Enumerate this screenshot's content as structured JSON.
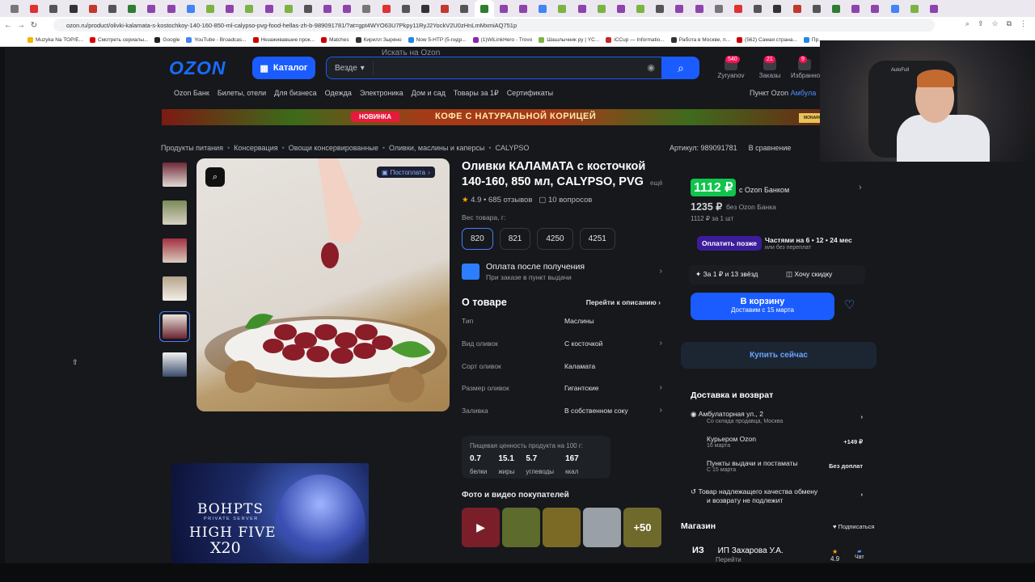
{
  "browser": {
    "tab_count": 48,
    "url": "ozon.ru/product/olivki-kalamata-s-kostochkoy-140-160-850-ml-calypso-pvg-food-hellas-zh-b-989091781/?at=gpt4WYO63U7Pkpy11RyJ2YockV2U0zHnLmMxmiAQ751p",
    "bookmarks": [
      "Muzyka Na TOP/E...",
      "Смотреть сериалы...",
      "Google",
      "YouTube - Broadcas...",
      "Незаживавшие прок...",
      "Matches",
      "Кирилл Зыряно",
      "Now 5-HTP (5-гидр...",
      "(1)WiLinkHero - Trovo",
      "Шашлычник ру | YC...",
      "iCCup — Informatio...",
      "Работа в Москве, п...",
      "(562) Самая страна...",
      "Пр..."
    ]
  },
  "header": {
    "logo": "OZON",
    "catalog": "Каталог",
    "search_scope": "Везде",
    "search_placeholder": "Искать на Ozon",
    "user": [
      {
        "label": "Zyryanov",
        "badge": "540"
      },
      {
        "label": "Заказы",
        "badge": "21"
      },
      {
        "label": "Избранно",
        "badge": "9"
      }
    ]
  },
  "subnav": [
    "Ozon Банк",
    "Билеты, отели",
    "Для бизнеса",
    "Одежда",
    "Электроника",
    "Дом и сад",
    "Товары за 1₽",
    "Сертификаты"
  ],
  "pickup": {
    "label": "Пункт Ozon",
    "value": "Амбула"
  },
  "promo": {
    "tag": "НОВИНКА",
    "text": "КОФЕ С НАТУРАЛЬНОЙ КОРИЦЕЙ",
    "brand": "MONARCH"
  },
  "breadcrumbs": [
    "Продукты питания",
    "Консервация",
    "Овощи консервированные",
    "Оливки, маслины и каперсы",
    "CALYPSO"
  ],
  "article": {
    "label": "Артикул: 989091781",
    "compare": "В сравнение"
  },
  "product": {
    "postoplata": "Постоплата",
    "title_line1": "Оливки КАЛАМАТА с косточкой",
    "title_line2": "140-160, 850 мл, CALYPSO, PVG",
    "more": "ещё",
    "rating": "4.9",
    "reviews": "685 отзывов",
    "questions": "10 вопросов",
    "weight_label": "Вес товара, г:",
    "weights": [
      "820",
      "821",
      "4250",
      "4251"
    ],
    "weight_selected_index": 0,
    "pay_after": {
      "title": "Оплата после получения",
      "sub": "При заказе в пункт выдачи"
    },
    "about_title": "О товаре",
    "about_link": "Перейти к описанию",
    "attributes": [
      {
        "k": "Тип",
        "v": "Маслины"
      },
      {
        "k": "Вид оливок",
        "v": "С косточкой"
      },
      {
        "k": "Сорт оливок",
        "v": "Каламата"
      },
      {
        "k": "Размер оливок",
        "v": "Гигантские"
      },
      {
        "k": "Заливка",
        "v": "В собственном соку"
      }
    ],
    "nutrition": {
      "title": "Пищевая ценность продукта на 100 г:",
      "values": [
        {
          "v": "0.7",
          "k": "белки"
        },
        {
          "v": "15.1",
          "k": "жиры"
        },
        {
          "v": "5.7",
          "k": "углеводы"
        },
        {
          "v": "167",
          "k": "ккал"
        }
      ]
    },
    "photos_title": "Фото и видео покупателей",
    "photos_more": "+50"
  },
  "ad": {
    "line1": "BOHPTS",
    "line2": "PRIVATE SERVER",
    "line3": "HIGH FIVE",
    "line4": "X20"
  },
  "price": {
    "ozon_bank": "1112 ₽",
    "ozon_bank_label": "с Ozon Банком",
    "regular": "1235 ₽",
    "regular_label": "без Ozon Банка",
    "per_unit": "1112 ₽ за 1 шт",
    "pay_later_btn": "Оплатить позже",
    "pay_later_text": "Частями на 6 • 12 • 24 мес",
    "pay_later_sub": "или без переплат",
    "bonus": "За 1 ₽ и 13 звёзд",
    "discount": "Хочу скидку",
    "cart": "В корзину",
    "cart_sub": "Доставим с 15 марта",
    "buy_now": "Купить сейчас"
  },
  "delivery": {
    "title": "Доставка и возврат",
    "address": "Амбулаторная ул., 2",
    "address_sub": "Со склада продавца, Москва",
    "rows": [
      {
        "t": "Курьером Ozon",
        "s": "16 марта",
        "r": "+149 ₽"
      },
      {
        "t": "Пункты выдачи и постаматы",
        "s": "С 15 марта",
        "r": "Без доплат"
      }
    ],
    "return_text_1": "Товар надлежащего качества обмену",
    "return_text_2": "и возврату не подлежит"
  },
  "shop": {
    "title": "Магазин",
    "subscribe": "Подписаться",
    "name": "ИП Захарова У.А.",
    "logo": "ИЗ",
    "go": "Перейти",
    "rating": "4.9",
    "chat": "Чат"
  },
  "webcam": {
    "label": "AutoFull"
  },
  "colors": {
    "bg": "#16181c",
    "accent": "#1a5cff",
    "green": "#10c44c",
    "pink": "#f91155"
  }
}
